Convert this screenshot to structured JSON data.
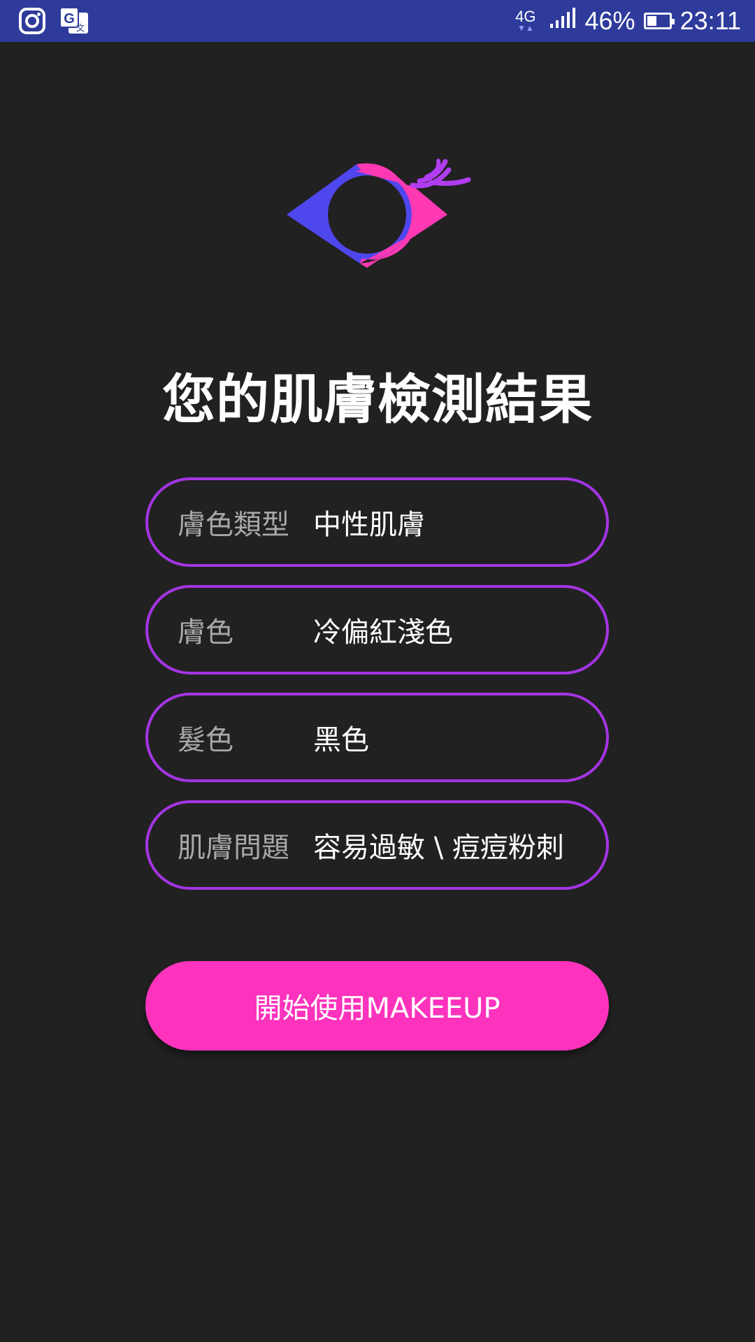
{
  "status_bar": {
    "network": "4G",
    "battery_percent": "46%",
    "battery_level": 0.46,
    "time": "23:11",
    "left_icons": [
      "instagram-icon",
      "google-translate-icon"
    ]
  },
  "logo": {
    "icon": "eye-logo-icon",
    "colors": {
      "blue": "#4f47ee",
      "pink": "#ff38b3",
      "lash": "#b13df0"
    }
  },
  "title": "您的肌膚檢測結果",
  "results": [
    {
      "label": "膚色類型",
      "value": "中性肌膚"
    },
    {
      "label": "膚色",
      "value": "冷偏紅淺色"
    },
    {
      "label": "髮色",
      "value": "黑色"
    },
    {
      "label": "肌膚問題",
      "value": "容易過敏 \\ 痘痘粉刺"
    }
  ],
  "cta_label": "開始使用MAKEEUP",
  "colors": {
    "status_bar": "#2e3b9b",
    "background": "#222122",
    "field_border": "#a435e4",
    "cta_background": "#fd33bd"
  }
}
